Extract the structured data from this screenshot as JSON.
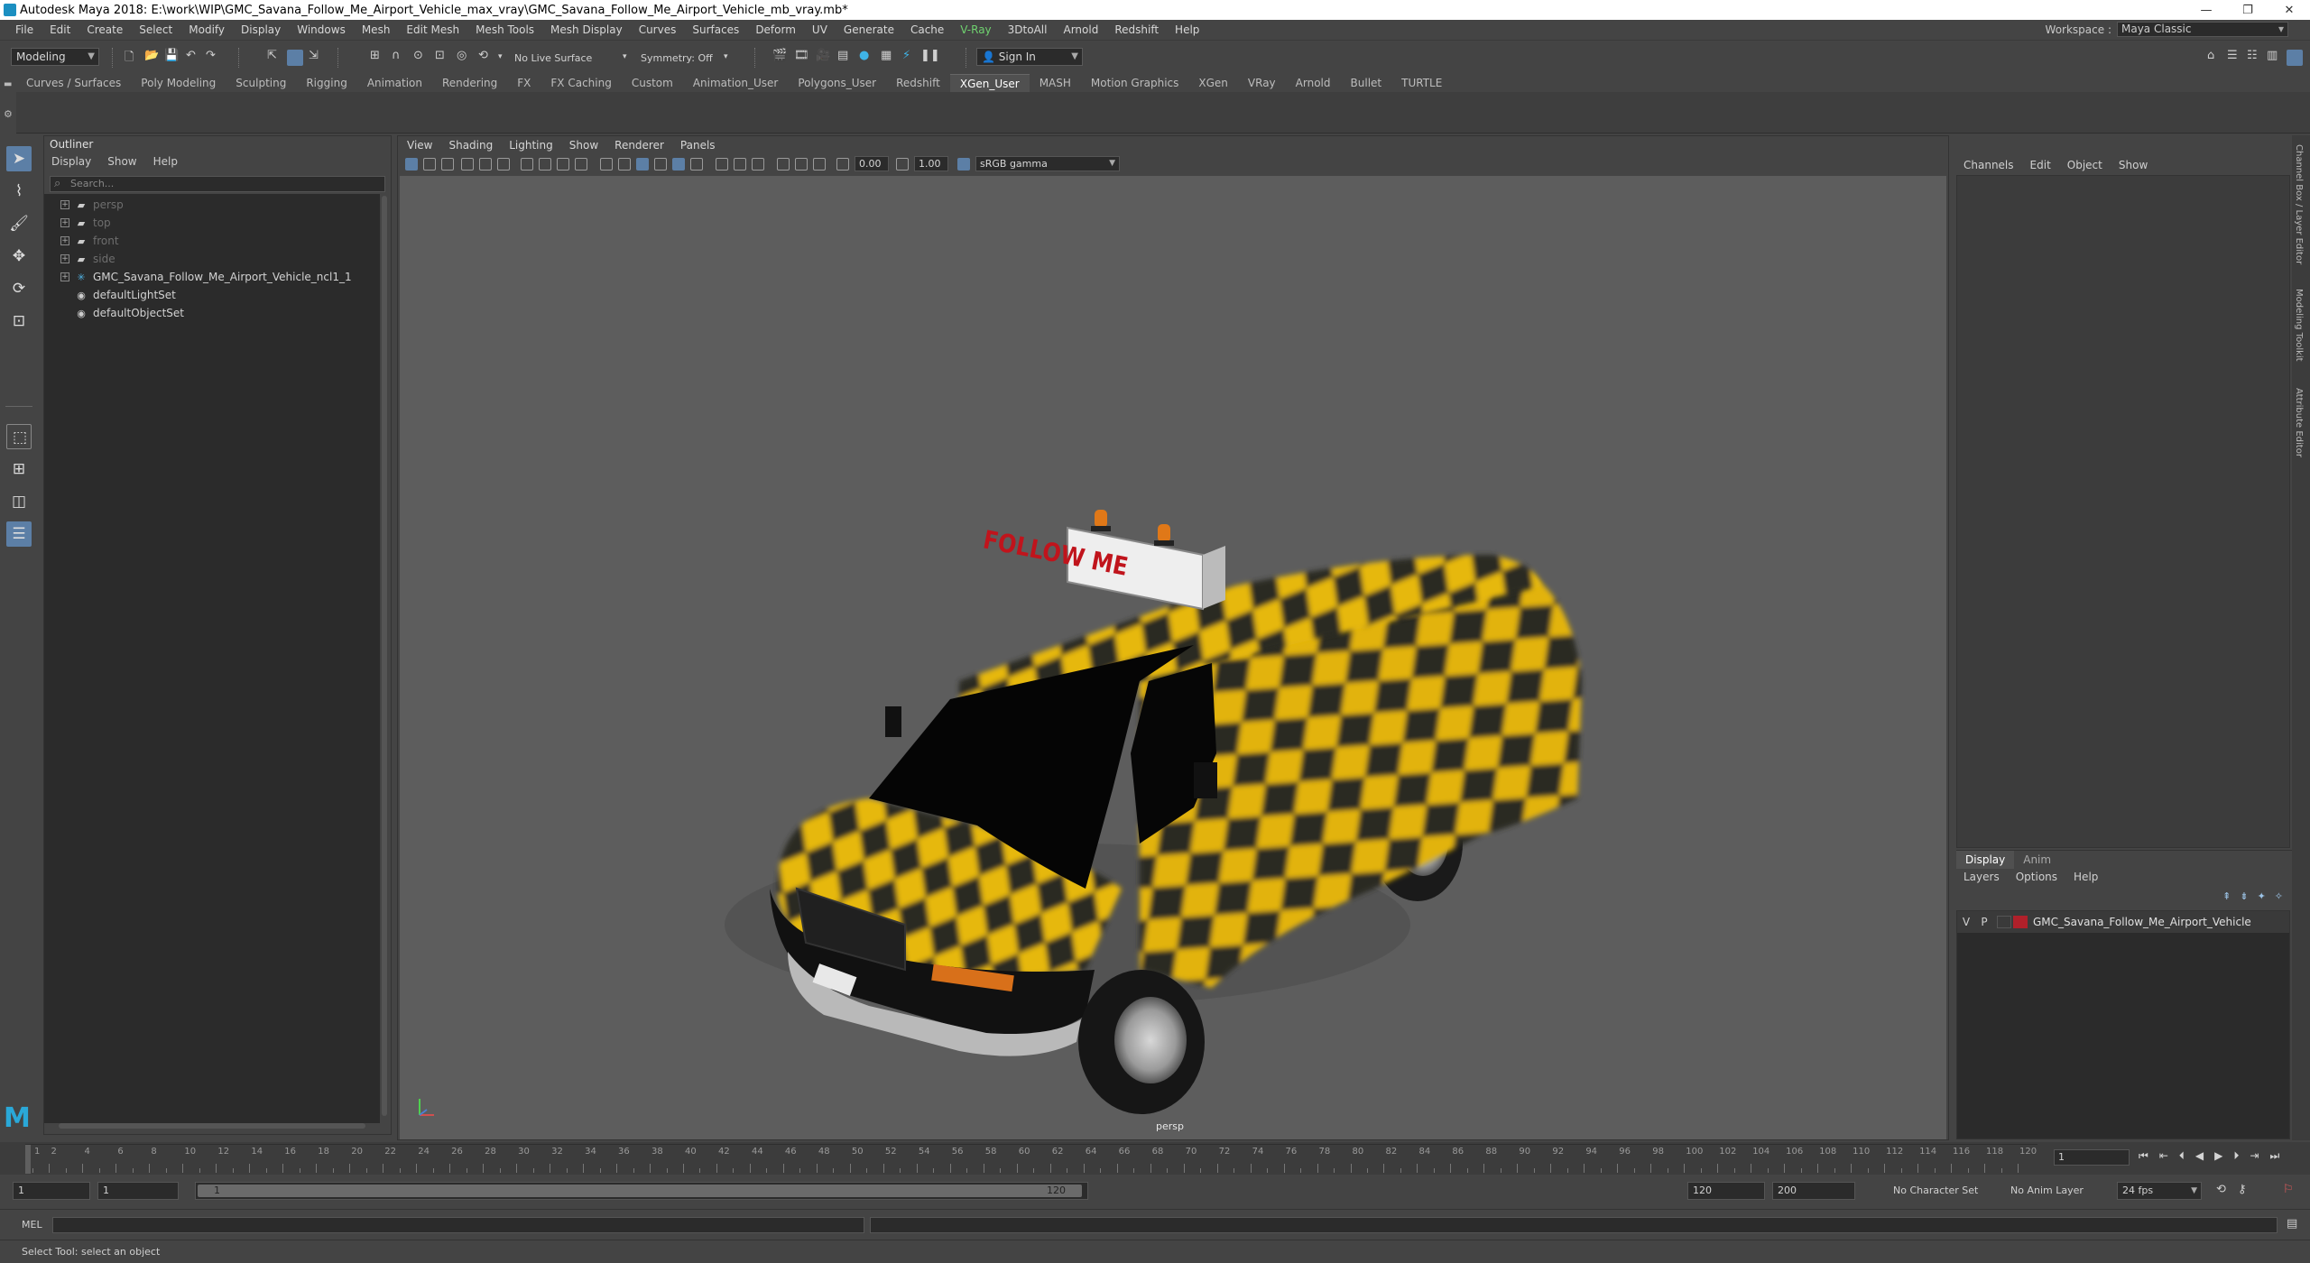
{
  "window": {
    "title": "Autodesk Maya 2018: E:\\work\\WIP\\GMC_Savana_Follow_Me_Airport_Vehicle_max_vray\\GMC_Savana_Follow_Me_Airport_Vehicle_mb_vray.mb*",
    "controls": [
      "—",
      "❐",
      "✕"
    ]
  },
  "menubar": {
    "items": [
      "File",
      "Edit",
      "Create",
      "Select",
      "Modify",
      "Display",
      "Windows",
      "Mesh",
      "Edit Mesh",
      "Mesh Tools",
      "Mesh Display",
      "Curves",
      "Surfaces",
      "Deform",
      "UV",
      "Generate",
      "Cache",
      "V-Ray",
      "3DtoAll",
      "Arnold",
      "Redshift",
      "Help"
    ],
    "workspace_label": "Workspace :",
    "workspace_value": "Maya Classic"
  },
  "statusline": {
    "mode": "Modeling",
    "live_surface": "No Live Surface",
    "symmetry": "Symmetry: Off",
    "sign_in": "Sign In"
  },
  "shelf": {
    "tabs": [
      "Curves / Surfaces",
      "Poly Modeling",
      "Sculpting",
      "Rigging",
      "Animation",
      "Rendering",
      "FX",
      "FX Caching",
      "Custom",
      "Animation_User",
      "Polygons_User",
      "Redshift",
      "XGen_User",
      "MASH",
      "Motion Graphics",
      "XGen",
      "VRay",
      "Arnold",
      "Bullet",
      "TURTLE"
    ],
    "active": "XGen_User"
  },
  "outliner": {
    "title": "Outliner",
    "menu": [
      "Display",
      "Show",
      "Help"
    ],
    "search_placeholder": "Search...",
    "items": [
      {
        "label": "persp",
        "dim": true
      },
      {
        "label": "top",
        "dim": true
      },
      {
        "label": "front",
        "dim": true
      },
      {
        "label": "side",
        "dim": true
      },
      {
        "label": "GMC_Savana_Follow_Me_Airport_Vehicle_ncl1_1",
        "dim": false
      },
      {
        "label": "defaultLightSet",
        "dim": false
      },
      {
        "label": "defaultObjectSet",
        "dim": false
      }
    ]
  },
  "viewport": {
    "menu": [
      "View",
      "Shading",
      "Lighting",
      "Show",
      "Renderer",
      "Panels"
    ],
    "exposure": "0.00",
    "gamma": "1.00",
    "color_space": "sRGB gamma",
    "camera_label": "persp",
    "sign_text": "FOLLOW ME"
  },
  "channelbox": {
    "menu": [
      "Channels",
      "Edit",
      "Object",
      "Show"
    ]
  },
  "layereditor": {
    "tabs": [
      "Display",
      "Anim"
    ],
    "active_tab": "Display",
    "menu": [
      "Layers",
      "Options",
      "Help"
    ],
    "layer": {
      "v": "V",
      "p": "P",
      "name": "GMC_Savana_Follow_Me_Airport_Vehicle",
      "color": "#b0202a"
    }
  },
  "sidetabs": [
    "Channel Box / Layer Editor",
    "Modeling Toolkit",
    "Attribute Editor"
  ],
  "timeslider": {
    "labels": [
      "1",
      "2",
      "4",
      "6",
      "8",
      "10",
      "12",
      "14",
      "16",
      "18",
      "20",
      "22",
      "24",
      "26",
      "28",
      "30",
      "32",
      "34",
      "36",
      "38",
      "40",
      "42",
      "44",
      "46",
      "48",
      "50",
      "52",
      "54",
      "56",
      "58",
      "60",
      "62",
      "64",
      "66",
      "68",
      "70",
      "72",
      "74",
      "76",
      "78",
      "80",
      "82",
      "84",
      "86",
      "88",
      "90",
      "92",
      "94",
      "96",
      "98",
      "100",
      "102",
      "104",
      "106",
      "108",
      "110",
      "112",
      "114",
      "116",
      "118",
      "120"
    ],
    "current_frame": "1"
  },
  "rangeslider": {
    "start": "1",
    "start2": "1",
    "range_start_label": "1",
    "range_end_label": "120",
    "end": "120",
    "end2": "200",
    "character_set": "No Character Set",
    "anim_layer": "No Anim Layer",
    "fps": "24 fps"
  },
  "cmdline": {
    "label": "MEL"
  },
  "helpline": {
    "text": "Select Tool: select an object"
  },
  "colors": {
    "accent": "#5c7fa6",
    "viewport_bg": "#5d5d5d",
    "checker_yellow": "#e6b80c",
    "checker_dark": "#2a2a22"
  }
}
